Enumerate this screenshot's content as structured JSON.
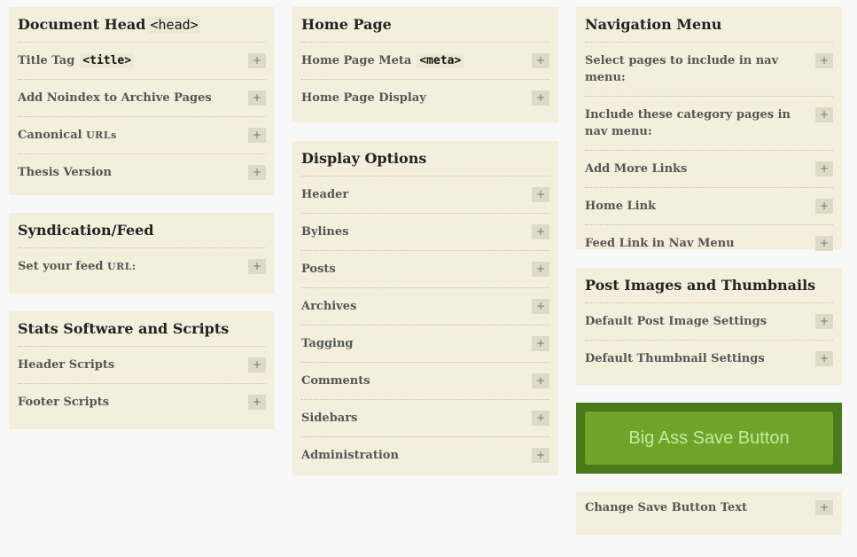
{
  "document_head": {
    "title": "Document Head",
    "title_code": "<head>",
    "items": [
      {
        "label": "Title Tag",
        "code": "<title>"
      },
      {
        "label": "Add Noindex to Archive Pages"
      },
      {
        "label": "Canonical",
        "smallcaps": "URLs"
      },
      {
        "label": "Thesis Version"
      }
    ]
  },
  "syndication": {
    "title": "Syndication/Feed",
    "items": [
      {
        "label": "Set your feed",
        "smallcaps": "URL:"
      }
    ]
  },
  "stats": {
    "title": "Stats Software and Scripts",
    "items": [
      {
        "label": "Header Scripts"
      },
      {
        "label": "Footer Scripts"
      }
    ]
  },
  "home_page": {
    "title": "Home Page",
    "items": [
      {
        "label": "Home Page Meta",
        "code": "<meta>"
      },
      {
        "label": "Home Page Display"
      }
    ]
  },
  "display_options": {
    "title": "Display Options",
    "items": [
      {
        "label": "Header"
      },
      {
        "label": "Bylines"
      },
      {
        "label": "Posts"
      },
      {
        "label": "Archives"
      },
      {
        "label": "Tagging"
      },
      {
        "label": "Comments"
      },
      {
        "label": "Sidebars"
      },
      {
        "label": "Administration"
      }
    ]
  },
  "nav_menu": {
    "title": "Navigation Menu",
    "items": [
      {
        "label": "Select pages to include in nav menu:"
      },
      {
        "label": "Include these category pages in nav menu:"
      },
      {
        "label": "Add More Links"
      },
      {
        "label": "Home Link"
      },
      {
        "label": "Feed Link in Nav Menu"
      }
    ]
  },
  "post_images": {
    "title": "Post Images and Thumbnails",
    "items": [
      {
        "label": "Default Post Image Settings"
      },
      {
        "label": "Default Thumbnail Settings"
      }
    ]
  },
  "save": {
    "label": "Big Ass Save Button"
  },
  "save_text": {
    "items": [
      {
        "label": "Change Save Button Text"
      }
    ]
  },
  "expand_symbol": "+"
}
